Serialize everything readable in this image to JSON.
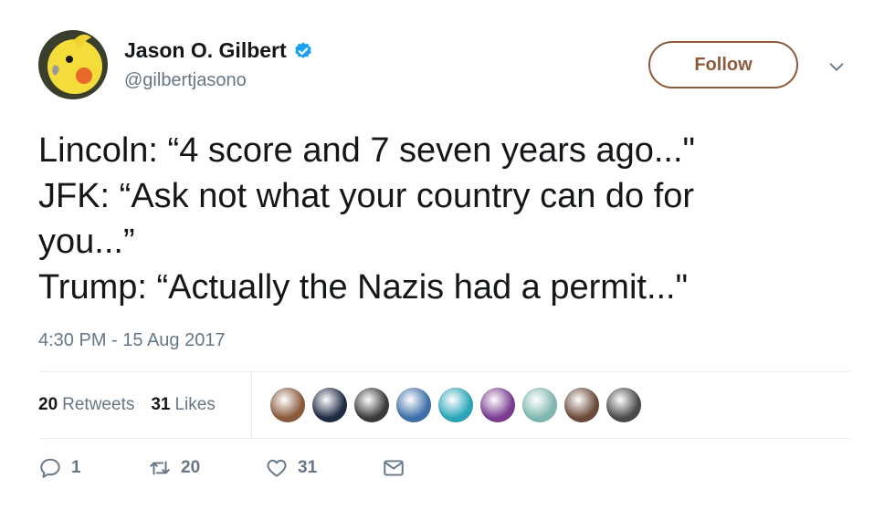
{
  "author": {
    "display_name": "Jason O. Gilbert",
    "handle": "@gilbertjasono",
    "verified": true
  },
  "follow_label": "Follow",
  "tweet": {
    "lines": [
      "Lincoln: “4 score and 7 seven years ago...\"",
      "JFK: “Ask not what your country can do for",
      "you...”",
      "Trump: “Actually the Nazis had a permit...\""
    ],
    "timestamp": "4:30 PM - 15 Aug 2017"
  },
  "stats": {
    "retweets_count": "20",
    "retweets_label": "Retweets",
    "likes_count": "31",
    "likes_label": "Likes"
  },
  "liker_avatar_colors": [
    "#8b5a3c",
    "#1f2a44",
    "#3a3a3a",
    "#3d6fa8",
    "#2aa6b8",
    "#7a3c8f",
    "#7fb8b0",
    "#6b4a3a",
    "#4a4a4a"
  ],
  "actions": {
    "reply_count": "1",
    "retweet_count": "20",
    "like_count": "31"
  },
  "colors": {
    "follow_border": "#8a5a3b",
    "verified": "#1da1f2",
    "secondary_text": "#657786"
  }
}
